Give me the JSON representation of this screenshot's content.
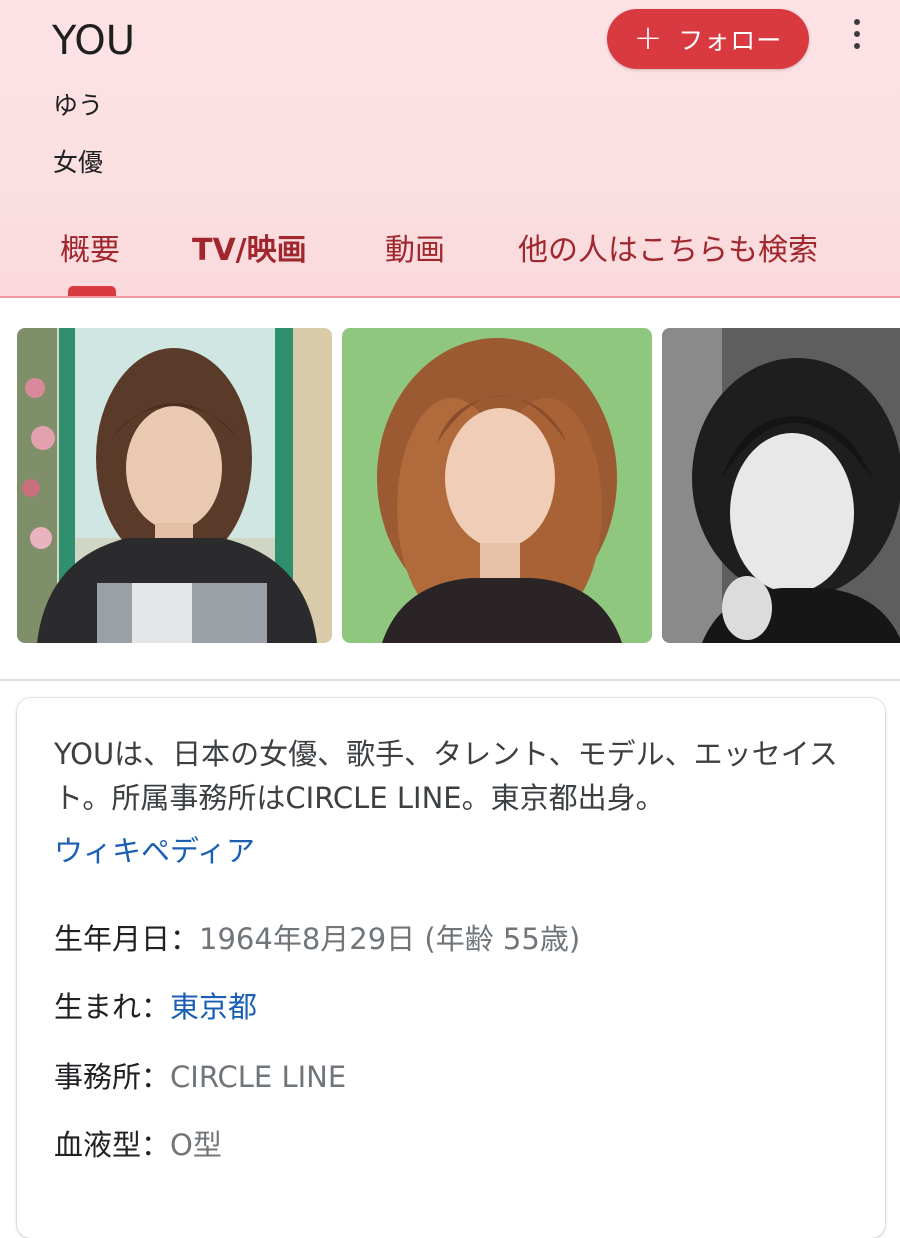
{
  "entity": {
    "name": "YOU",
    "reading": "ゆう",
    "occupation": "女優"
  },
  "follow_button": {
    "icon": "plus-icon",
    "label": "フォロー"
  },
  "more_button": {
    "icon": "more-vert-icon"
  },
  "tabs": [
    {
      "label": "概要",
      "selected": true
    },
    {
      "label": "TV/映画",
      "selected": false
    },
    {
      "label": "動画",
      "selected": false
    },
    {
      "label": "他の人はこちらも検索",
      "selected": false
    }
  ],
  "images": [
    {
      "alt": "YOU photo 1"
    },
    {
      "alt": "YOU photo 2"
    },
    {
      "alt": "YOU photo 3"
    }
  ],
  "summary": {
    "text": "YOUは、日本の女優、歌手、タレント、モデル、エッセイスト。所属事務所はCIRCLE LINE。東京都出身。",
    "source": "ウィキペディア"
  },
  "facts": [
    {
      "key": "生年月日：",
      "value": "1964年8月29日 (年齢 55歳)",
      "link": false
    },
    {
      "key": "生まれ：",
      "value": "東京都",
      "link": true
    },
    {
      "key": "事務所：",
      "value": "CIRCLE LINE",
      "link": false
    },
    {
      "key": "血液型：",
      "value": "O型",
      "link": false
    }
  ],
  "colors": {
    "header_bg": "#fde3e5",
    "accent": "#d93a40",
    "tab_text": "#a0272d",
    "link": "#1a5fb4"
  }
}
